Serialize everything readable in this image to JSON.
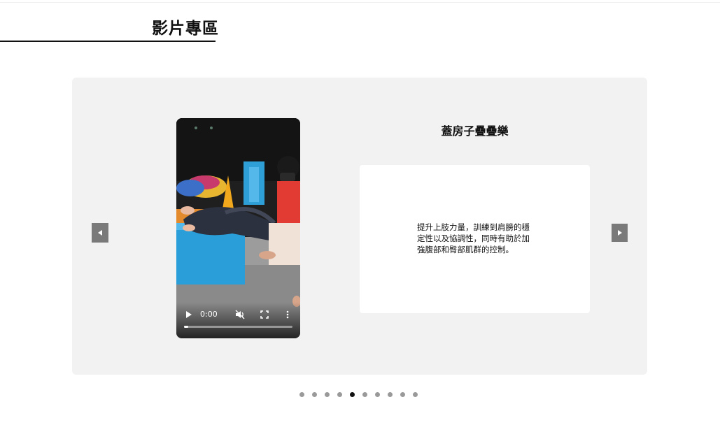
{
  "section": {
    "title": "影片專區"
  },
  "carousel": {
    "prev_icon": "triangle-left-icon",
    "next_icon": "triangle-right-icon",
    "slide": {
      "title": "蓋房子疊疊樂",
      "description": "提升上肢力量，訓練到肩膀的穩定性以及協調性，同時有助於加強腹部和臀部肌群的控制。",
      "video": {
        "time": "0:00",
        "progress": 0.04,
        "controls": [
          "play-icon",
          "mute-icon",
          "fullscreen-icon",
          "more-vertical-icon"
        ]
      }
    },
    "dots": {
      "count": 10,
      "active_index": 4
    }
  },
  "colors": {
    "panel_bg": "#f2f2f2",
    "nav_bg": "#7a7a7a",
    "dot_inactive": "#9a9a9a",
    "dot_active": "#111111"
  }
}
